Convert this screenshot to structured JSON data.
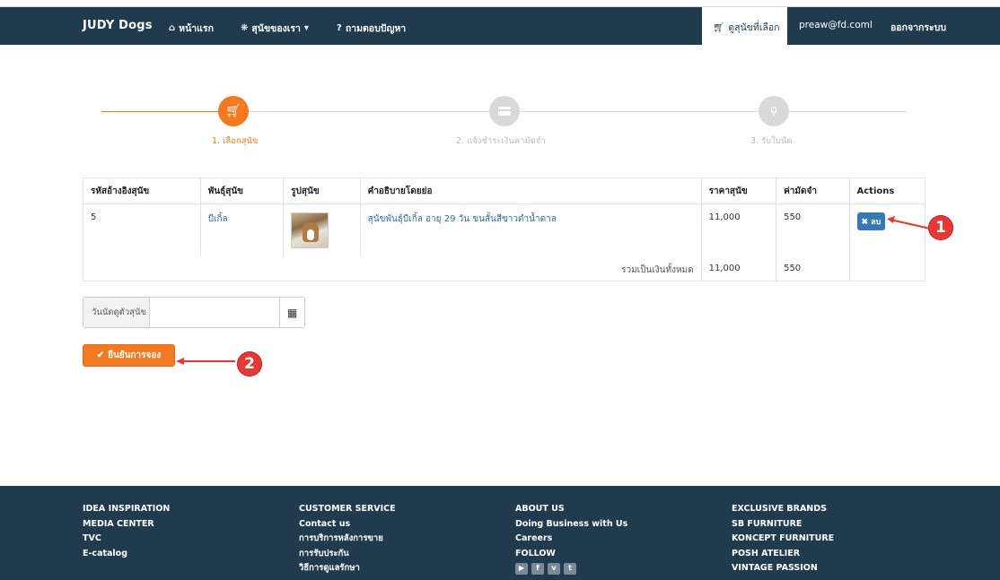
{
  "navbar": {
    "brand": "JUDY Dogs",
    "home": "หน้าแรก",
    "our_dogs": "สุนัขของเรา",
    "faq": "ถามตอบปัญหา",
    "cart": "ดูสุนัขที่เลือก",
    "user": "preaw@fd.coml",
    "logout": "ออกจากระบบ"
  },
  "steps": [
    {
      "label": "1. เลือกสุนัข",
      "icon": "cart-icon",
      "active": true
    },
    {
      "label": "2. แจ้งชำระเงินค่ามัดจำ",
      "icon": "card-icon",
      "active": false
    },
    {
      "label": "3. รับใบนัด",
      "icon": "key-icon",
      "active": false
    }
  ],
  "table": {
    "headers": [
      "รหัสอ้างอิงสุนัข",
      "พันธุ์สุนัข",
      "รูปสุนัข",
      "คำอธิบายโดยย่อ",
      "ราคาสุนัข",
      "ค่ามัดจำ",
      "Actions"
    ],
    "rows": [
      {
        "id": "5",
        "breed": "บีเกิ้ล",
        "image": "beagle-photo",
        "desc": "สุนัขพันธุ์บีเกิ้ล อายุ 29 วัน ขนสั้นสีขาวดำน้ำตาล",
        "price": "11,000",
        "deposit": "550",
        "action": "ลบ"
      }
    ],
    "total_label": "รวมเป็นเงินทั้งหมด",
    "total_price": "11,000",
    "total_deposit": "550"
  },
  "appointment": {
    "label": "วันนัดดูตัวสุนัข",
    "value": "",
    "calendar_icon": "calendar-icon"
  },
  "confirm_label": "ยืนยันการจอง",
  "callouts": [
    "1",
    "2"
  ],
  "footer": {
    "col1": [
      "IDEA INSPIRATION",
      "MEDIA CENTER",
      "TVC",
      "E-catalog"
    ],
    "col2": [
      "CUSTOMER SERVICE",
      "Contact us",
      "การบริการหลังการขาย",
      "การรับประกัน",
      "วิธีการดูแลรักษา"
    ],
    "col3": [
      "ABOUT US",
      "Doing Business with Us",
      "Careers",
      "FOLLOW"
    ],
    "col4": [
      "EXCLUSIVE BRANDS",
      "SB FURNITURE",
      "KONCEPT FURNITURE",
      "POSH ATELIER",
      "VINTAGE PASSION"
    ],
    "social": [
      "youtube-icon",
      "facebook-icon",
      "vimeo-icon",
      "twitter-icon"
    ]
  },
  "colors": {
    "navbar": "#1f3b4d",
    "accent": "#f47920",
    "primary": "#337ab7",
    "callout": "#e53935"
  }
}
